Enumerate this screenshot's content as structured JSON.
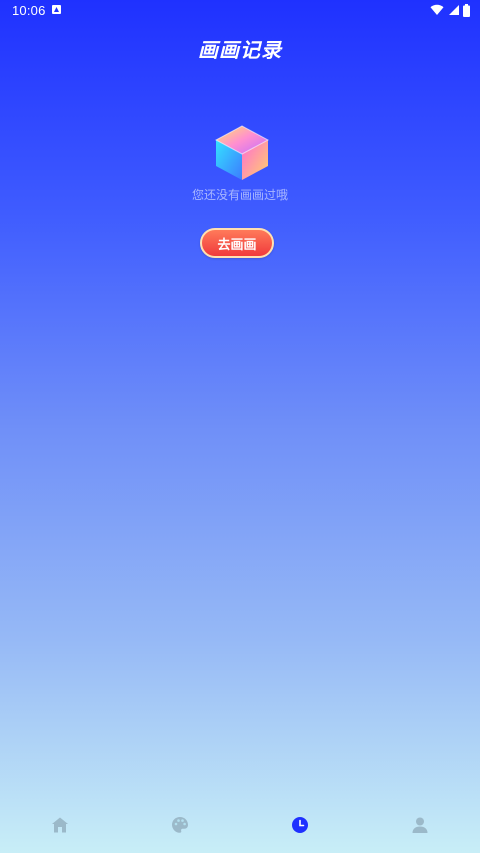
{
  "status_bar": {
    "time": "10:06",
    "icons": [
      "app-notification-icon",
      "wifi-icon",
      "signal-icon",
      "battery-icon"
    ]
  },
  "header": {
    "title": "画画记录"
  },
  "empty_state": {
    "message": "您还没有画画过哦",
    "illustration": "gem-cube-icon",
    "button_label": "去画画"
  },
  "bottom_nav": {
    "items": [
      {
        "icon": "home-icon",
        "active": false
      },
      {
        "icon": "palette-icon",
        "active": false
      },
      {
        "icon": "clock-icon",
        "active": true
      },
      {
        "icon": "person-icon",
        "active": false
      }
    ],
    "active_color": "#1f31ff",
    "inactive_color": "#9bb9c9"
  },
  "colors": {
    "background_top": "#1f31ff",
    "background_bottom": "#c8eef7",
    "button_start": "#ff7a5a",
    "button_end": "#f03a3c"
  }
}
